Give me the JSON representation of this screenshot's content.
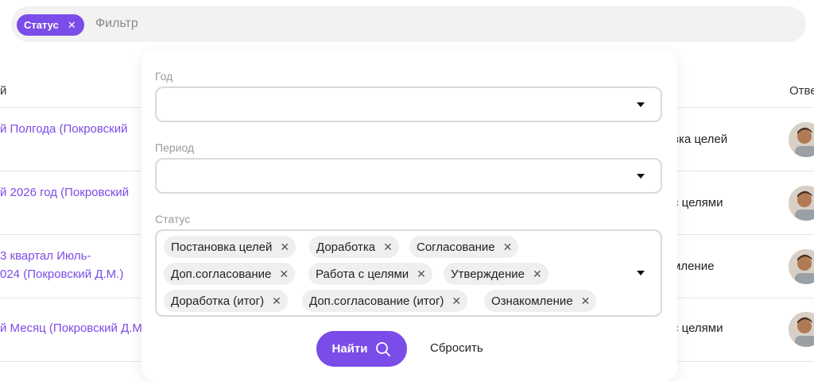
{
  "filter_bar": {
    "status_chip_label": "Статус",
    "placeholder": "Фильтр"
  },
  "table": {
    "headers": {
      "name": "й",
      "responsible": "Отве"
    },
    "rows": [
      {
        "name_lines": [
          "й Полгода (Покровский"
        ],
        "stage": "вка целей"
      },
      {
        "name_lines": [
          "й 2026 год (Покровский"
        ],
        "stage": "с целями"
      },
      {
        "name_lines": [
          "3 квартал Июль-",
          "024 (Покровский Д.М.)"
        ],
        "stage": "мление"
      },
      {
        "name_lines": [
          "й Месяц (Покровский Д.М"
        ],
        "stage": "с целями"
      }
    ]
  },
  "popup": {
    "year_label": "Год",
    "year_value": "",
    "period_label": "Период",
    "period_value": "",
    "status_label": "Статус",
    "status_chips": [
      "Постановка целей",
      "Доработка",
      "Согласование",
      "Доп.согласование",
      "Работа с целями",
      "Утверждение",
      "Доработка (итог)",
      "Доп.согласование (итог)",
      "Ознакомление"
    ],
    "find_label": "Найти",
    "reset_label": "Сбросить"
  },
  "colors": {
    "accent": "#7a4ce8",
    "chip_bg": "#efefef",
    "border": "#d9d9d9"
  }
}
